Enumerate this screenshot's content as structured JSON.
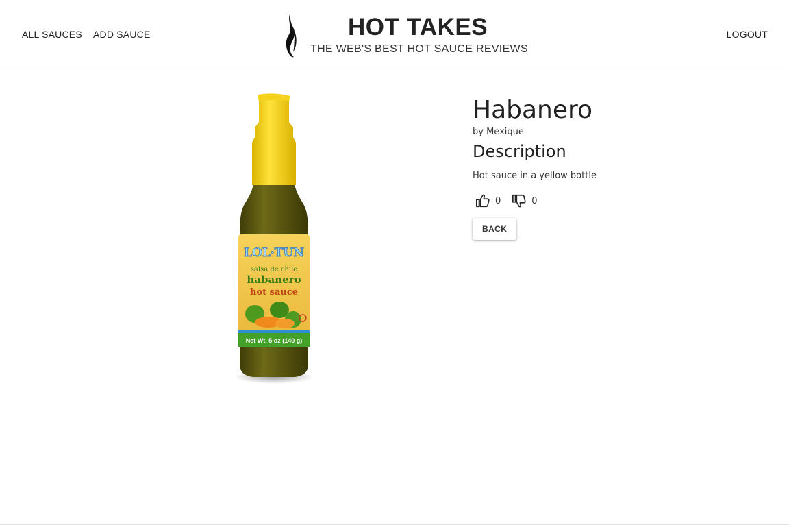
{
  "nav": {
    "all_sauces": "ALL SAUCES",
    "add_sauce": "ADD SAUCE",
    "logout": "LOGOUT"
  },
  "brand": {
    "title": "HOT TAKES",
    "subtitle": "THE WEB'S BEST HOT SAUCE REVIEWS",
    "logo_icon": "flame-icon"
  },
  "sauce": {
    "name": "Habanero",
    "manufacturer": "by Mexique",
    "description_heading": "Description",
    "description": "Hot sauce in a yellow bottle",
    "likes": "0",
    "dislikes": "0",
    "image_icon": "hot-sauce-bottle",
    "label": {
      "brand": "LOL·TUN",
      "line1": "salsa de chile",
      "line2": "habanero",
      "line3": "hot sauce",
      "weight": "Net Wt. 5 oz  (140 g)"
    }
  },
  "actions": {
    "back": "BACK"
  },
  "colors": {
    "cap": "#f7d417",
    "sauce": "#5f5a10",
    "label": "#f2c84a",
    "text": "#212121"
  }
}
